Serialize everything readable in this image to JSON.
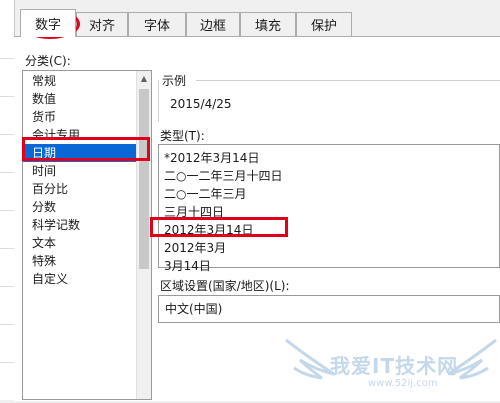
{
  "tabs": [
    "数字",
    "对齐",
    "字体",
    "边框",
    "填充",
    "保护"
  ],
  "active_tab": "数字",
  "category_label": "分类(C):",
  "categories": [
    "常规",
    "数值",
    "货币",
    "会计专用",
    "日期",
    "时间",
    "百分比",
    "分数",
    "科学记数",
    "文本",
    "特殊",
    "自定义"
  ],
  "selected_category": "日期",
  "sample_label": "示例",
  "sample_value": "2015/4/25",
  "type_label": "类型(T):",
  "types": [
    "*2012年3月14日",
    "二○一二年三月十四日",
    "二○一二年三月",
    "三月十四日",
    "2012年3月14日",
    "2012年3月",
    "3月14日"
  ],
  "locale_label": "区域设置(国家/地区)(L):",
  "locale_value": "中文(中国)",
  "watermark": {
    "text": "我爱IT技术网",
    "url": "www.52ij.com"
  },
  "colors": {
    "highlight": "#0a68d6",
    "annotation": "#e0001a"
  }
}
